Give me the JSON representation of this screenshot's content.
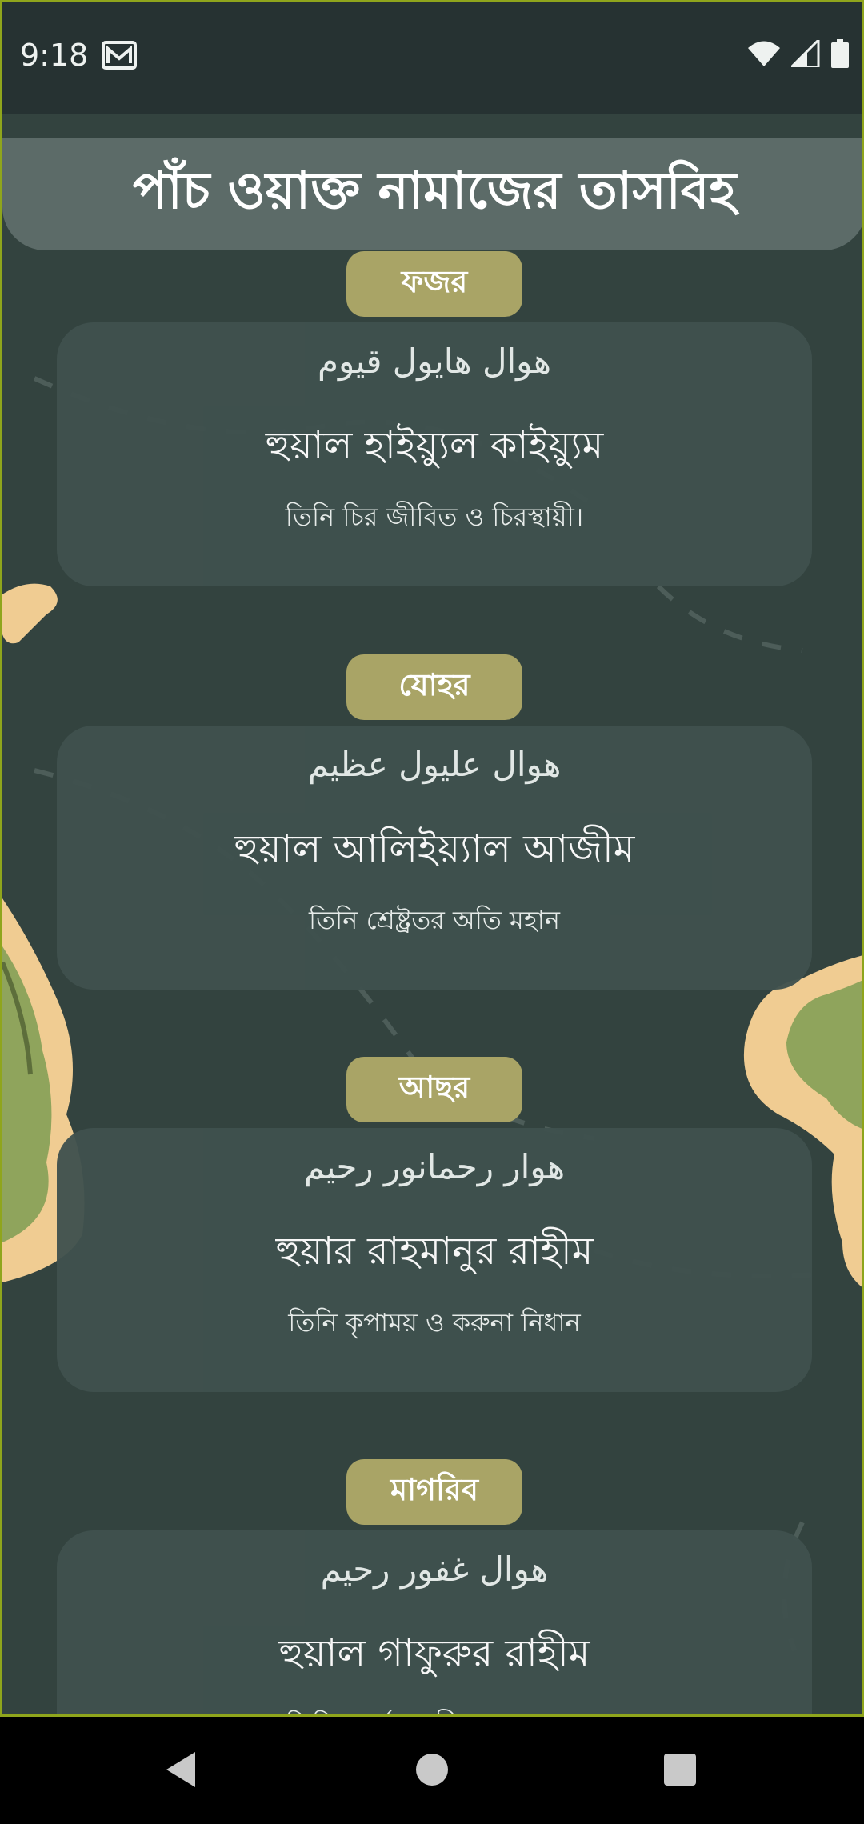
{
  "status": {
    "time": "9:18"
  },
  "header": {
    "title": "পাঁচ ওয়াক্ত নামাজের তাসবিহ"
  },
  "prayers": [
    {
      "name": "ফজর",
      "arabic": "هوال هايول قيوم",
      "bangla": "হুয়াল হাইয়্যুল কাইয়্যুম",
      "meaning": "তিনি চির জীবিত ও চিরস্থায়ী।"
    },
    {
      "name": "যোহর",
      "arabic": "هوال عليول عظيم",
      "bangla": "হুয়াল আলিইয়্যাল আজীম",
      "meaning": "তিনি শ্রেষ্ট্রতর অতি মহান"
    },
    {
      "name": "আছর",
      "arabic": "هوار رحمانور رحيم",
      "bangla": "হুয়ার রাহমানুর রাহীম",
      "meaning": "তিনি কৃপাময় ও করুনা নিধান"
    },
    {
      "name": "মাগরিব",
      "arabic": "هوال غفور رحيم",
      "bangla": "হুয়াল গাফুরুর রাহীম",
      "meaning": "তিনি মার্জনাকারী ও করুণাময়"
    }
  ],
  "icons": {
    "mail": "mail-icon",
    "wifi": "wifi-icon",
    "signal": "signal-icon",
    "battery": "battery-icon",
    "back": "back-icon",
    "home": "home-icon",
    "recents": "recents-icon"
  },
  "colors": {
    "background": "#33433f",
    "header": "#5c6b68",
    "pill": "#a9a466",
    "card": "#3f514e"
  }
}
